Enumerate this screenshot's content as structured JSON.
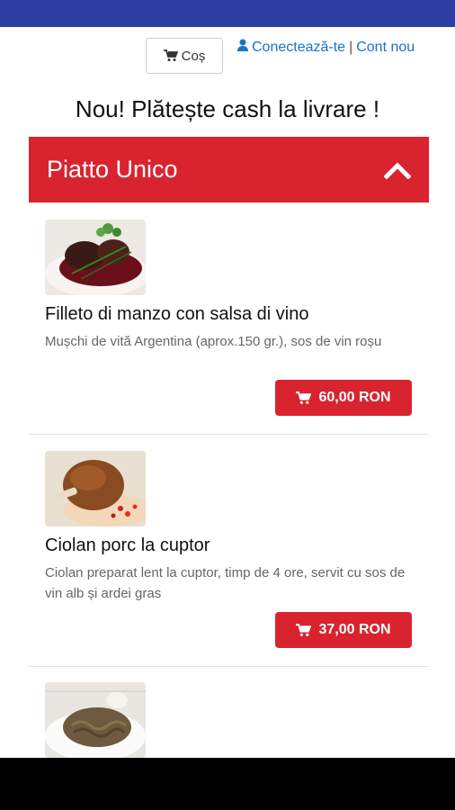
{
  "header": {
    "cart_label": "Coș",
    "login_label": "Conectează-te",
    "separator": "|",
    "register_label": "Cont nou"
  },
  "promo_text": "Nou! Plătește cash la livrare !",
  "category": {
    "title": "Piatto Unico",
    "expanded": true
  },
  "products": [
    {
      "name": "Filleto di manzo con salsa di vino",
      "description": "Mușchi de vită Argentina (aprox.150 gr.), sos de vin roșu",
      "price": "60,00 RON"
    },
    {
      "name": "Ciolan porc la cuptor",
      "description": "Ciolan preparat lent la cuptor, timp de 4 ore, servit cu sos de vin alb și ardei gras",
      "price": "37,00 RON"
    }
  ],
  "colors": {
    "accent": "#d9232e",
    "status_bar": "#2b3da0",
    "link": "#1a73c8"
  }
}
